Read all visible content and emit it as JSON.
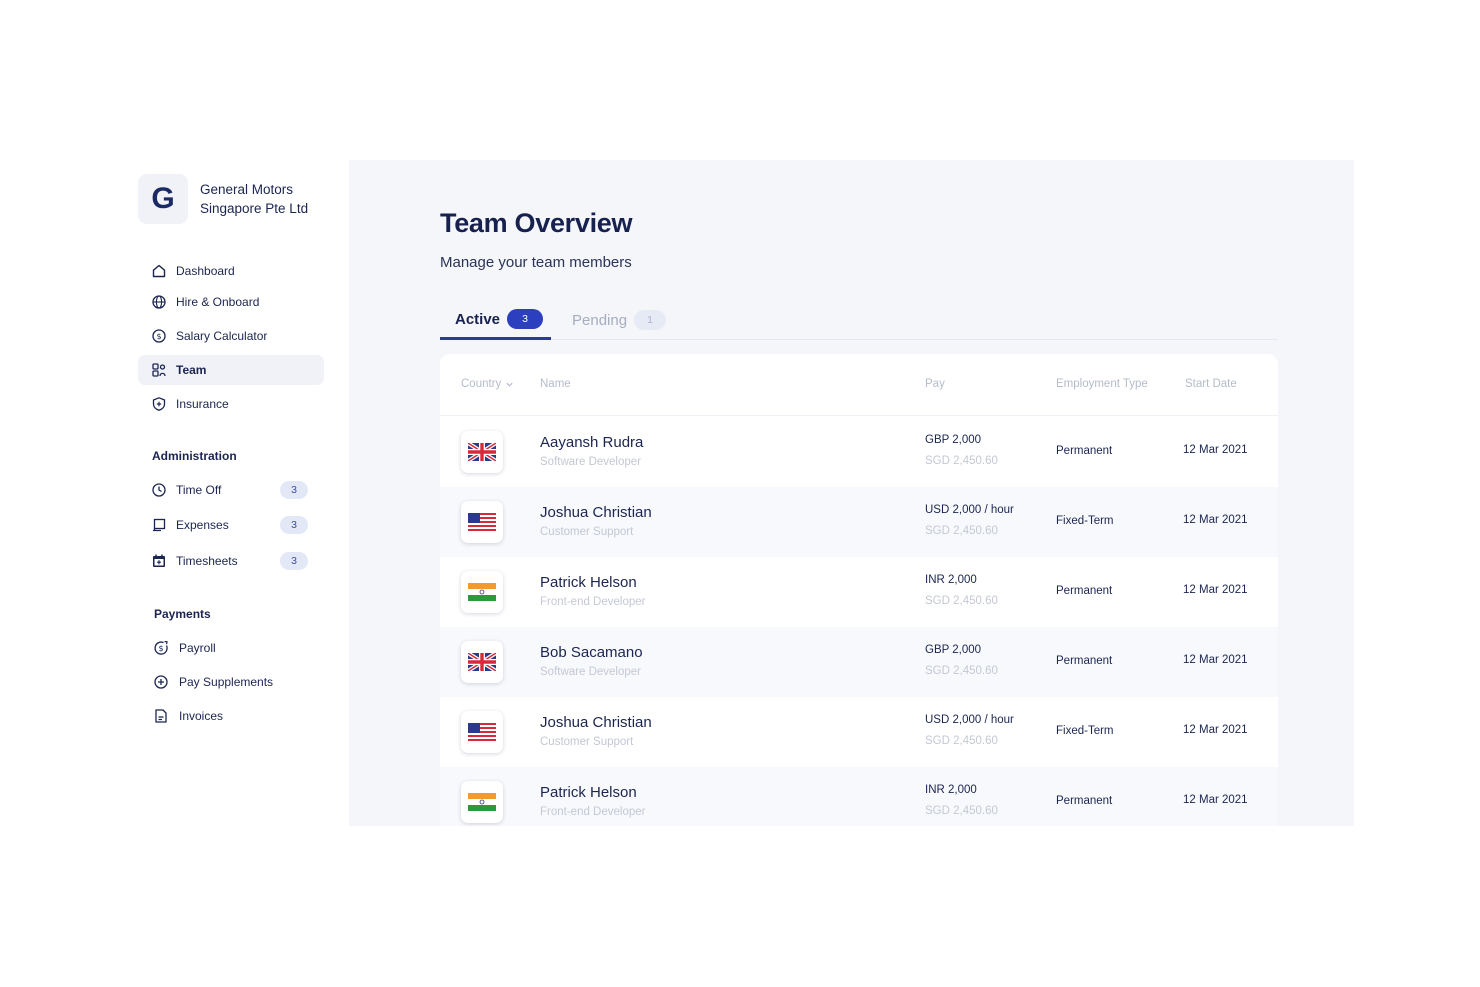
{
  "company": {
    "logo_letter": "G",
    "name_line1": "General Motors",
    "name_line2": "Singapore Pte Ltd"
  },
  "nav": {
    "main": [
      {
        "label": "Dashboard",
        "icon": "home-icon"
      },
      {
        "label": "Hire & Onboard",
        "icon": "globe-icon"
      },
      {
        "label": "Salary Calculator",
        "icon": "dollar-circle-icon"
      },
      {
        "label": "Team",
        "icon": "users-icon",
        "active": true
      },
      {
        "label": "Insurance",
        "icon": "shield-icon"
      }
    ],
    "administration": {
      "title": "Administration",
      "items": [
        {
          "label": "Time Off",
          "icon": "clock-icon",
          "badge": "3"
        },
        {
          "label": "Expenses",
          "icon": "receipt-icon",
          "badge": "3"
        },
        {
          "label": "Timesheets",
          "icon": "calendar-icon",
          "badge": "3"
        }
      ]
    },
    "payments": {
      "title": "Payments",
      "items": [
        {
          "label": "Payroll",
          "icon": "payroll-icon"
        },
        {
          "label": "Pay Supplements",
          "icon": "plus-circle-icon"
        },
        {
          "label": "Invoices",
          "icon": "document-icon"
        }
      ]
    }
  },
  "page": {
    "title": "Team Overview",
    "subtitle": "Manage your team members"
  },
  "tabs": [
    {
      "label": "Active",
      "count": "3",
      "active": true
    },
    {
      "label": "Pending",
      "count": "1",
      "active": false
    }
  ],
  "table": {
    "headers": {
      "country": "Country",
      "name": "Name",
      "pay": "Pay",
      "type": "Employment Type",
      "date": "Start Date"
    },
    "rows": [
      {
        "flag": "uk",
        "name": "Aayansh Rudra",
        "role": "Software Developer",
        "pay": "GBP 2,000",
        "pay_sgd": "SGD 2,450.60",
        "type": "Permanent",
        "date": "12 Mar 2021"
      },
      {
        "flag": "us",
        "name": "Joshua Christian",
        "role": "Customer Support",
        "pay": "USD 2,000 / hour",
        "pay_sgd": "SGD 2,450.60",
        "type": "Fixed-Term",
        "date": "12 Mar 2021"
      },
      {
        "flag": "in",
        "name": "Patrick Helson",
        "role": "Front-end Developer",
        "pay": "INR 2,000",
        "pay_sgd": "SGD 2,450.60",
        "type": "Permanent",
        "date": "12 Mar 2021"
      },
      {
        "flag": "uk",
        "name": "Bob Sacamano",
        "role": "Software Developer",
        "pay": "GBP 2,000",
        "pay_sgd": "SGD 2,450.60",
        "type": "Permanent",
        "date": "12 Mar 2021"
      },
      {
        "flag": "us",
        "name": "Joshua Christian",
        "role": "Customer Support",
        "pay": "USD 2,000 / hour",
        "pay_sgd": "SGD 2,450.60",
        "type": "Fixed-Term",
        "date": "12 Mar 2021"
      },
      {
        "flag": "in",
        "name": "Patrick Helson",
        "role": "Front-end Developer",
        "pay": "INR 2,000",
        "pay_sgd": "SGD 2,450.60",
        "type": "Permanent",
        "date": "12 Mar 2021"
      }
    ]
  },
  "colors": {
    "accent": "#2b3fbf",
    "text": "#1b2550",
    "muted": "#c4c8d4",
    "panel": "#f5f6fa"
  }
}
